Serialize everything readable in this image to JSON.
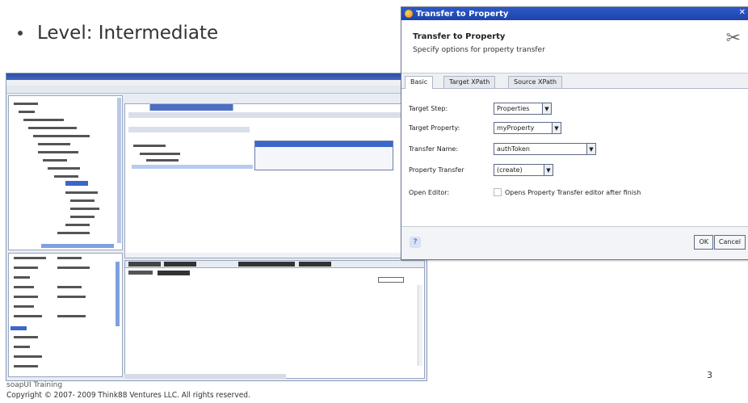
{
  "slide": {
    "bullet": "Level: Intermediate",
    "footer_line1": "soapUI Training",
    "footer_line2": "Copyright © 2007- 2009 Think88 Ventures LLC. All rights reserved.",
    "page_number": "3"
  },
  "dialog": {
    "title": "Transfer to Property",
    "header_title": "Transfer to Property",
    "header_subtitle": "Specify options for property transfer",
    "tabs": [
      "Basic",
      "Target XPath",
      "Source XPath"
    ],
    "fields": [
      {
        "label": "Target Step:",
        "value": "Properties"
      },
      {
        "label": "Target Property:",
        "value": "myProperty"
      },
      {
        "label": "Transfer Name:",
        "value": "authToken"
      },
      {
        "label": "Property Transfer",
        "value": "(create)"
      }
    ],
    "open_editor_label": "Open Editor:",
    "open_editor_checkbox": "Opens Property Transfer editor after finish",
    "buttons": {
      "ok": "OK",
      "cancel": "Cancel"
    },
    "icons": {
      "title": "soapui-icon",
      "header": "tools-icon",
      "help": "help-icon"
    }
  }
}
